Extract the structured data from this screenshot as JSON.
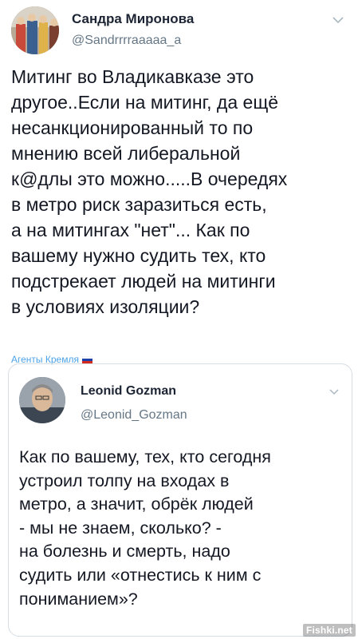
{
  "tweet": {
    "author_name": "Сандра Миронова",
    "author_handle": "@Sandrrrraaaaa_a",
    "body_lines": [
      "Митинг во Владикавказе это",
      "другое..Если на митинг, да ещё",
      "несанкционированный то по",
      "мнению всей либеральной",
      "к@длы это можно.....В очередях",
      "в метро риск заразиться есть,",
      "а на митингах \"нет\"... Как по",
      "вашему нужно судить тех, кто",
      "подстрекает людей на митинги",
      "в условиях изоляции?"
    ],
    "footer_label": "Агенты Кремля",
    "footer_icon": "russian-flag-icon"
  },
  "quoted_tweet": {
    "author_name": "Leonid Gozman",
    "author_handle": "@Leonid_Gozman",
    "body_lines": [
      "Как по вашему, тех, кто сегодня",
      "устроил толпу на входах в",
      "метро, а значит, обрёк людей",
      "- мы не знаем, сколько? -",
      "на болезнь и смерть, надо",
      "судить или «отнестись к ним с",
      "пониманием»?"
    ]
  },
  "watermark": "Fishki.net",
  "colors": {
    "text": "#141823",
    "secondary": "#657786",
    "link": "#4da3e8",
    "border": "#d6dde3"
  }
}
